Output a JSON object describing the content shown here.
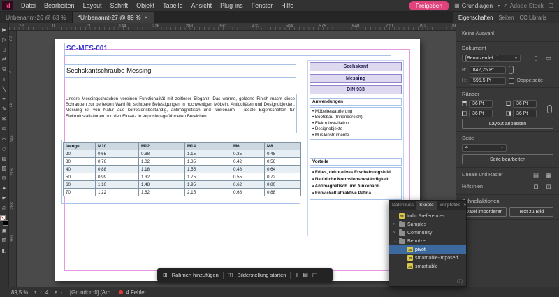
{
  "colors": {
    "accent_pink": "#e0437c",
    "logo_pink": "#ff4f7d",
    "selection_blue": "#3d6a9e",
    "frame_blue": "#a8c2e8",
    "margin_guide_pink": "#e39ae0",
    "table_header_bg": "#ccd7df",
    "table_alt_row": "#e7eef4",
    "badge_bg": "#ded9ef",
    "badge_border": "#9183cc",
    "error_red": "#e13b3b"
  },
  "menubar": {
    "logo": "Id",
    "items": [
      "Datei",
      "Bearbeiten",
      "Layout",
      "Schrift",
      "Objekt",
      "Tabelle",
      "Ansicht",
      "Plug-ins",
      "Fenster",
      "Hilfe"
    ],
    "share": "Freigeben",
    "workspace": "Grundlagen",
    "stock": "Adobe Stock"
  },
  "doc_tabs": [
    {
      "label": "Unbenannt-26 @ 63 %",
      "active": false
    },
    {
      "label": "*Unbenannt-27 @ 89 %",
      "active": true
    }
  ],
  "panel_tabs": [
    {
      "label": "Eigenschaften",
      "active": true
    },
    {
      "label": "Seiten",
      "active": false
    },
    {
      "label": "CC Libraris",
      "active": false
    }
  ],
  "rulers": {
    "h": [
      "72",
      "0",
      "72",
      "144",
      "216",
      "288",
      "360",
      "432",
      "504",
      "576",
      "648",
      "720",
      "792",
      "864"
    ],
    "v": [
      "72",
      "0",
      "72",
      "144",
      "216",
      "288",
      "360"
    ]
  },
  "tools": [
    {
      "name": "selection-tool",
      "glyph": "▶"
    },
    {
      "name": "direct-selection-tool",
      "glyph": "▷"
    },
    {
      "name": "page-tool",
      "glyph": "▯"
    },
    {
      "name": "gap-tool",
      "glyph": "⇄"
    },
    {
      "name": "content-collector-tool",
      "glyph": "⧉"
    },
    {
      "name": "type-tool",
      "glyph": "T"
    },
    {
      "name": "line-tool",
      "glyph": "╲"
    },
    {
      "name": "pen-tool",
      "glyph": "✒"
    },
    {
      "name": "pencil-tool",
      "glyph": "✎"
    },
    {
      "name": "rectangle-frame-tool",
      "glyph": "⊠"
    },
    {
      "name": "rectangle-tool",
      "glyph": "▭"
    },
    {
      "name": "scissors-tool",
      "glyph": "✄"
    },
    {
      "name": "free-transform-tool",
      "glyph": "◇"
    },
    {
      "name": "gradient-tool",
      "glyph": "▧"
    },
    {
      "name": "gradient-feather-tool",
      "glyph": "▨"
    },
    {
      "name": "note-tool",
      "glyph": "✉"
    },
    {
      "name": "eyedropper-tool",
      "glyph": "✦"
    },
    {
      "name": "hand-tool",
      "glyph": "☛"
    },
    {
      "name": "zoom-tool",
      "glyph": "◎"
    }
  ],
  "document_page": {
    "sku": "SC-MES-001",
    "heading": "Sechskantschraube Messing",
    "body": "Unsere Messingschrauben vereinen Funktionalität mit zeitloser Eleganz. Das warme, goldene Finish macht diese Schrauben zur perfekten Wahl für sichtbare Befestigungen in hochwertigen Möbeln, Antiquitäten und Designobjekten. Messing ist von Natur aus korrosionsbeständig, antimagnetisch und funkenarm – ideale Eigenschaften für Elektroinstallationen und den Einsatz in explosionsgefährdeten Bereichen.",
    "table": {
      "headers": [
        "laenge",
        "M10",
        "M12",
        "M14",
        "M6",
        "M8"
      ],
      "rows": [
        [
          "20",
          "0.65",
          "0.88",
          "1.15",
          "0.35",
          "0.48"
        ],
        [
          "30",
          "0.76",
          "1.02",
          "1.35",
          "0.42",
          "0.56"
        ],
        [
          "40",
          "0.88",
          "1.18",
          "1.55",
          "0.48",
          "0.64"
        ],
        [
          "50",
          "0.99",
          "1.32",
          "1.75",
          "0.55",
          "0.72"
        ],
        [
          "60",
          "1.10",
          "1.48",
          "1.95",
          "0.62",
          "0.80"
        ],
        [
          "70",
          "1.22",
          "1.62",
          "2.15",
          "0.68",
          "0.88"
        ]
      ]
    },
    "badges": [
      "Sechskant",
      "Messing",
      "DIN 933"
    ],
    "applications": {
      "title": "Anwendungen",
      "items": [
        "Möbelrestaurierung",
        "Bootsbau (Innenbereich)",
        "Elektroinstallation",
        "Designobjekte",
        "Musikinstrumente"
      ]
    },
    "benefits": {
      "title": "Vorteile",
      "items": [
        "Edles, dekoratives Erscheinungsbild",
        "Natürliche Korrosionsbeständigkeit",
        "Antimagnetisch und funkenarm",
        "Entwickelt attraktive Patina"
      ]
    }
  },
  "canvas_toolbar": {
    "add_frame": "Rahmen hinzufügen",
    "generate_image": "Bilderstellung starten",
    "more": "⋯"
  },
  "properties": {
    "no_selection": "Keine Auswahl",
    "document": {
      "title": "Dokument",
      "preset": "[Benutzerdef...]",
      "width_label": "B:",
      "width_value": "842,25 Pt",
      "height_label": "H:",
      "height_value": "595,5 Pt",
      "facing_label": "Doppelseite"
    },
    "margins": {
      "title": "Ränder",
      "top": "36 Pt",
      "bottom": "36 Pt",
      "left": "36 Pt",
      "right": "36 Pt",
      "adjust": "Layout anpassen"
    },
    "page": {
      "title": "Seite",
      "current": "4",
      "edit": "Seite bearbeiten"
    },
    "rulers_grids": "Lineale und Raster",
    "guides": "Hilfslinien",
    "quick": {
      "title": "Schnellaktionen",
      "import": "Datei importieren",
      "text_to_image": "Text zu Bild"
    }
  },
  "scripts_panel": {
    "tabs": [
      {
        "label": "Datenzuss",
        "active": false
      },
      {
        "label": "Skripte",
        "active": true
      },
      {
        "label": "Skriptetike",
        "active": false
      }
    ],
    "tree": [
      {
        "label": "Indic Preferences",
        "icon": "script",
        "depth": 0
      },
      {
        "label": "Samples",
        "icon": "folder",
        "depth": 0,
        "chevron": "›"
      },
      {
        "label": "Community",
        "icon": "folder",
        "depth": 0,
        "chevron": "›"
      },
      {
        "label": "Benutzer",
        "icon": "folder",
        "depth": 0,
        "chevron": "⌄",
        "expanded": true
      },
      {
        "label": "pivot",
        "icon": "script",
        "depth": 1,
        "selected": true
      },
      {
        "label": "smarttable-imposed",
        "icon": "script",
        "depth": 1
      },
      {
        "label": "smarttable",
        "icon": "script",
        "depth": 1
      }
    ]
  },
  "statusbar": {
    "zoom": "89,5 %",
    "page": "4",
    "preflight": "[Grundprofi] (Arb...",
    "errors": "4 Fehler"
  }
}
